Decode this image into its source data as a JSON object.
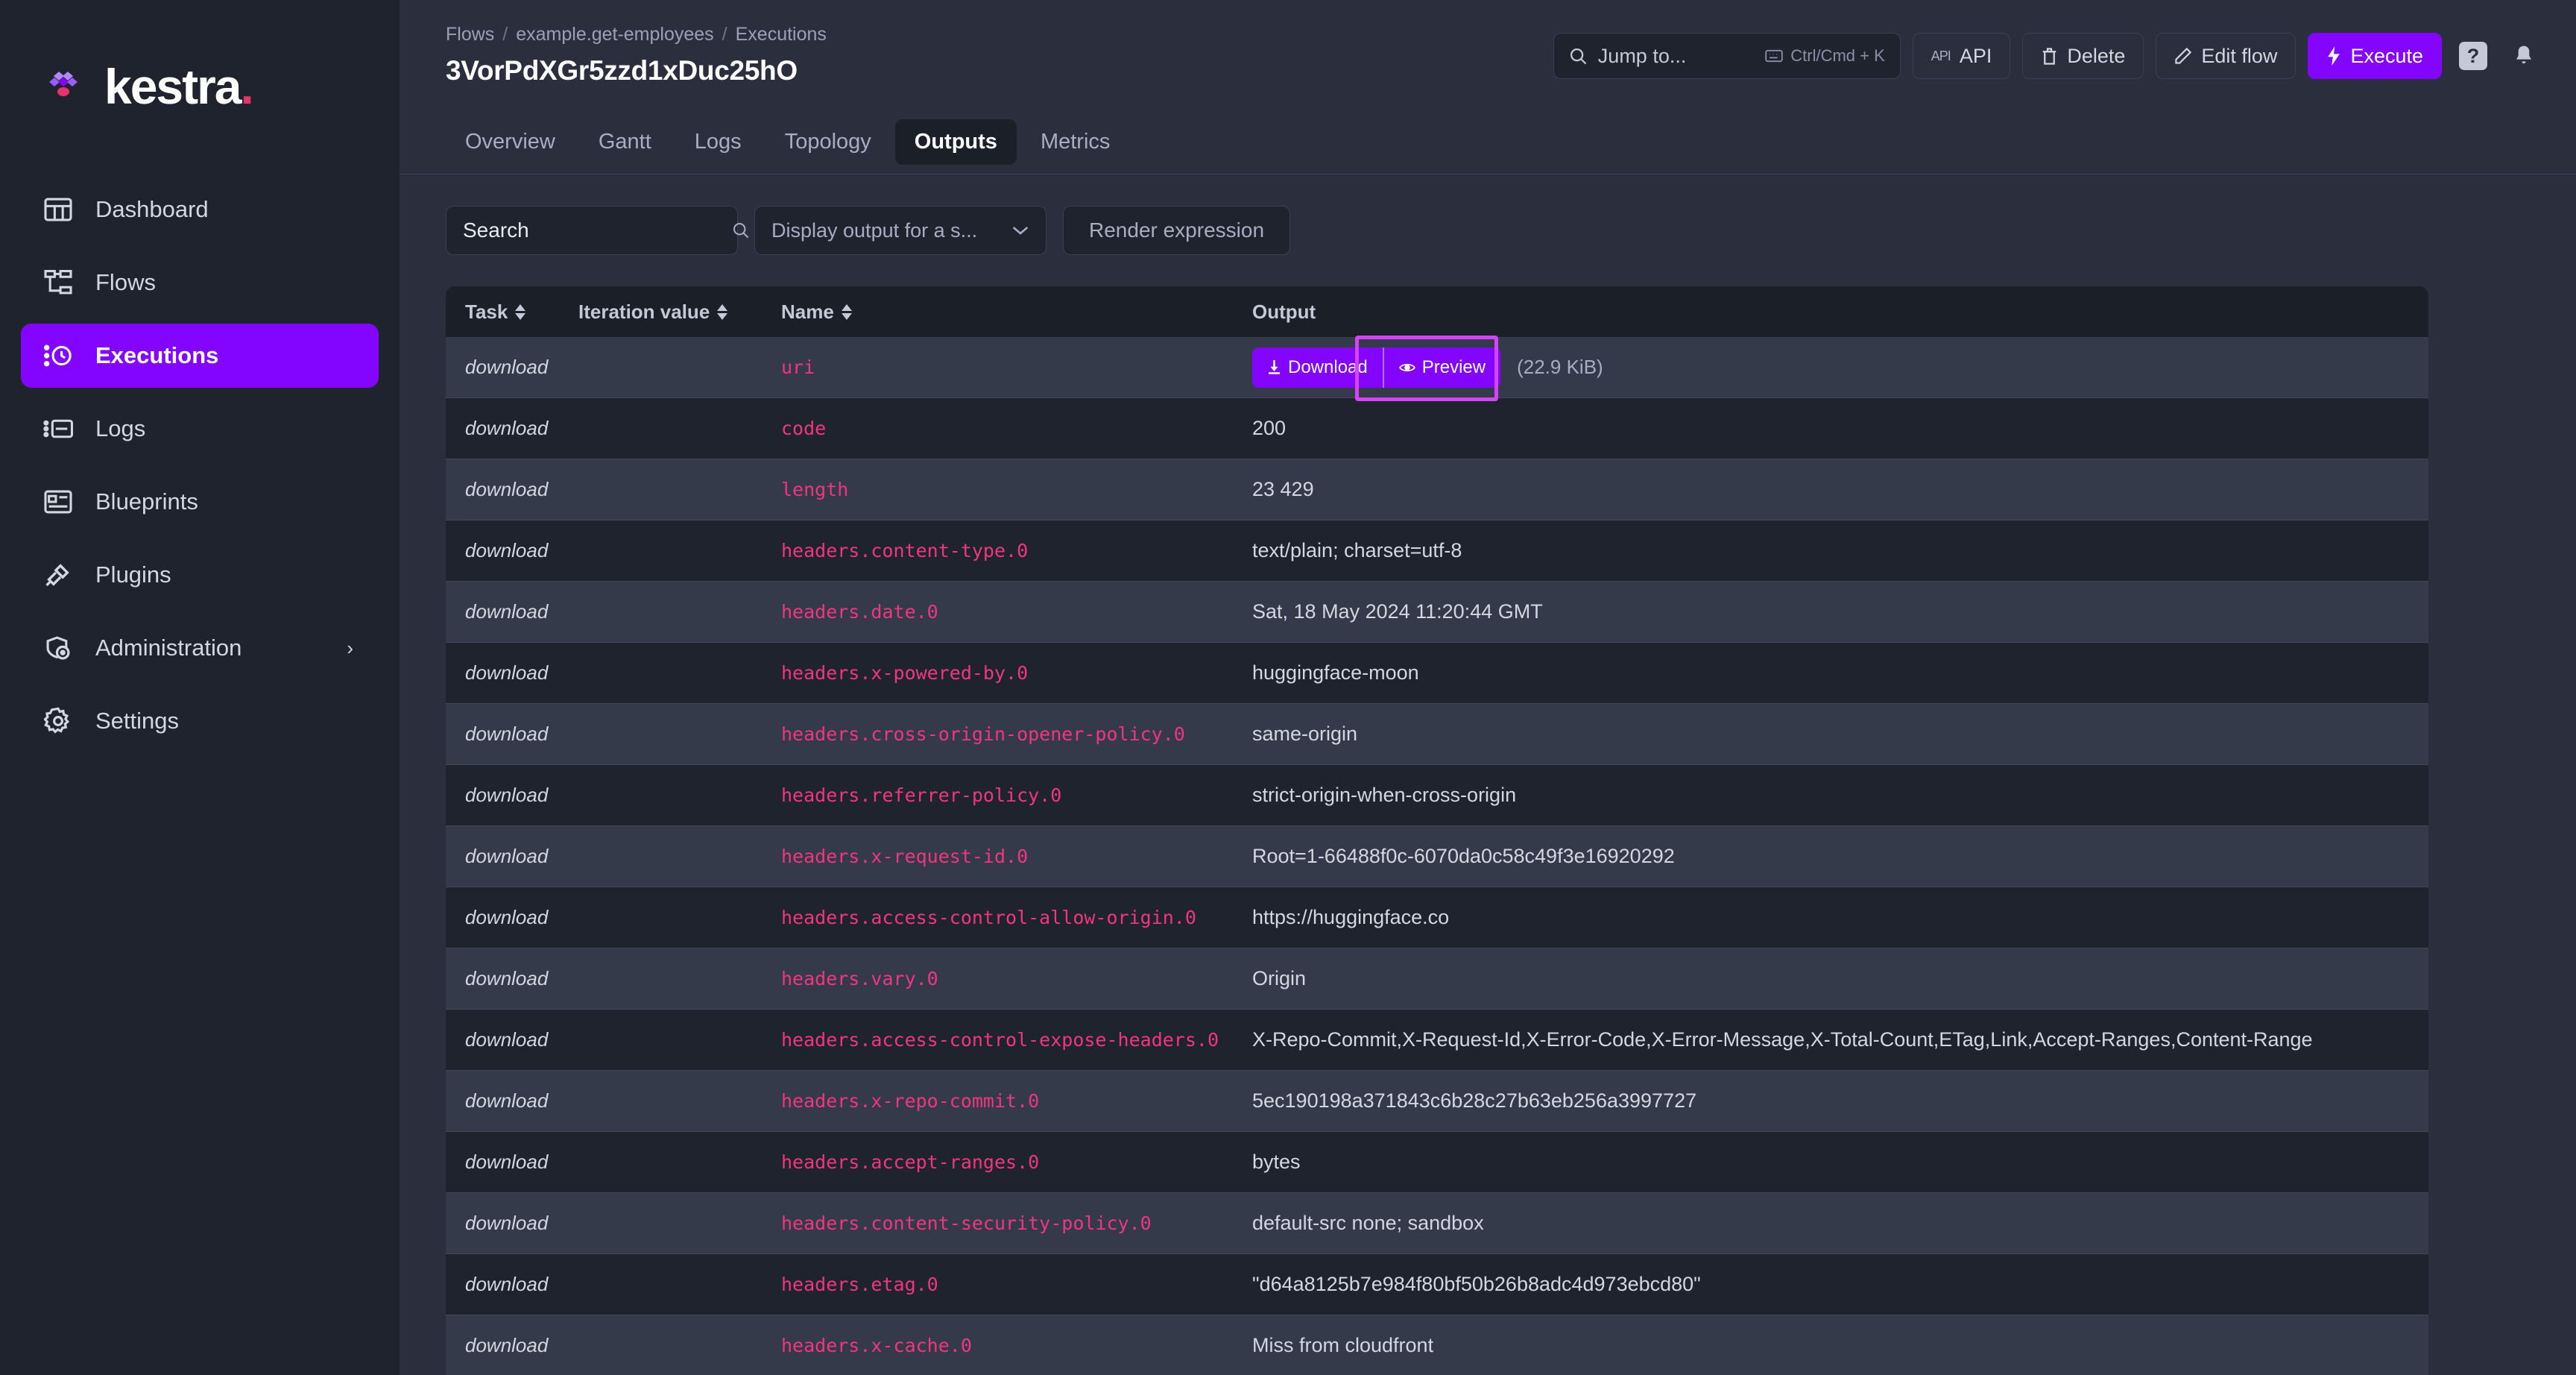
{
  "brand": {
    "name": "kestra",
    "dot": ".",
    "accent": "#8405ff",
    "pink": "#e5336b"
  },
  "sidebar": {
    "items": [
      {
        "label": "Dashboard",
        "icon": "dashboard-icon",
        "active": false,
        "chevron": ""
      },
      {
        "label": "Flows",
        "icon": "flows-icon",
        "active": false,
        "chevron": ""
      },
      {
        "label": "Executions",
        "icon": "executions-icon",
        "active": true,
        "chevron": ""
      },
      {
        "label": "Logs",
        "icon": "logs-icon",
        "active": false,
        "chevron": ""
      },
      {
        "label": "Blueprints",
        "icon": "blueprints-icon",
        "active": false,
        "chevron": ""
      },
      {
        "label": "Plugins",
        "icon": "plugins-icon",
        "active": false,
        "chevron": ""
      },
      {
        "label": "Administration",
        "icon": "administration-icon",
        "active": false,
        "chevron": "›"
      },
      {
        "label": "Settings",
        "icon": "settings-gear-icon",
        "active": false,
        "chevron": ""
      }
    ]
  },
  "header": {
    "breadcrumb": [
      "Flows",
      "example.get-employees",
      "Executions"
    ],
    "separator": "/",
    "title": "3VorPdXGr5zzd1xDuc25hO",
    "jump": {
      "placeholder": "Jump to...",
      "shortcut": "Ctrl/Cmd + K"
    },
    "buttons": [
      {
        "label": "API",
        "icon": "api-icon",
        "primary": false
      },
      {
        "label": "Delete",
        "icon": "trash-icon",
        "primary": false
      },
      {
        "label": "Edit flow",
        "icon": "pencil-icon",
        "primary": false
      },
      {
        "label": "Execute",
        "icon": "lightning-icon",
        "primary": true
      }
    ],
    "help_label": "?",
    "bell": "notifications-bell-icon"
  },
  "tabs": [
    {
      "label": "Overview",
      "active": false
    },
    {
      "label": "Gantt",
      "active": false
    },
    {
      "label": "Logs",
      "active": false
    },
    {
      "label": "Topology",
      "active": false
    },
    {
      "label": "Outputs",
      "active": true
    },
    {
      "label": "Metrics",
      "active": false
    }
  ],
  "filters": {
    "search_placeholder": "Search",
    "search_value": "",
    "select_label": "Display output for a s...",
    "render_button": "Render expression"
  },
  "table": {
    "columns": [
      {
        "label": "Task",
        "sortable": true
      },
      {
        "label": "Iteration value",
        "sortable": true
      },
      {
        "label": "Name",
        "sortable": true
      },
      {
        "label": "Output",
        "sortable": false
      }
    ],
    "rows": [
      {
        "task": "download",
        "iteration": "",
        "name": "uri",
        "output_type": "file",
        "download_label": "Download",
        "preview_label": "Preview",
        "size": "(22.9 KiB)",
        "highlighted": true
      },
      {
        "task": "download",
        "iteration": "",
        "name": "code",
        "output_type": "text",
        "output": "200"
      },
      {
        "task": "download",
        "iteration": "",
        "name": "length",
        "output_type": "text",
        "output": "23 429"
      },
      {
        "task": "download",
        "iteration": "",
        "name": "headers.content-type.0",
        "output_type": "text",
        "output": "text/plain; charset=utf-8"
      },
      {
        "task": "download",
        "iteration": "",
        "name": "headers.date.0",
        "output_type": "text",
        "output": "Sat, 18 May 2024 11:20:44 GMT"
      },
      {
        "task": "download",
        "iteration": "",
        "name": "headers.x-powered-by.0",
        "output_type": "text",
        "output": "huggingface-moon"
      },
      {
        "task": "download",
        "iteration": "",
        "name": "headers.cross-origin-opener-policy.0",
        "output_type": "text",
        "output": "same-origin"
      },
      {
        "task": "download",
        "iteration": "",
        "name": "headers.referrer-policy.0",
        "output_type": "text",
        "output": "strict-origin-when-cross-origin"
      },
      {
        "task": "download",
        "iteration": "",
        "name": "headers.x-request-id.0",
        "output_type": "text",
        "output": "Root=1-66488f0c-6070da0c58c49f3e16920292"
      },
      {
        "task": "download",
        "iteration": "",
        "name": "headers.access-control-allow-origin.0",
        "output_type": "text",
        "output": "https://huggingface.co"
      },
      {
        "task": "download",
        "iteration": "",
        "name": "headers.vary.0",
        "output_type": "text",
        "output": "Origin"
      },
      {
        "task": "download",
        "iteration": "",
        "name": "headers.access-control-expose-headers.0",
        "output_type": "text",
        "output": "X-Repo-Commit,X-Request-Id,X-Error-Code,X-Error-Message,X-Total-Count,ETag,Link,Accept-Ranges,Content-Range"
      },
      {
        "task": "download",
        "iteration": "",
        "name": "headers.x-repo-commit.0",
        "output_type": "text",
        "output": "5ec190198a371843c6b28c27b63eb256a3997727"
      },
      {
        "task": "download",
        "iteration": "",
        "name": "headers.accept-ranges.0",
        "output_type": "text",
        "output": "bytes"
      },
      {
        "task": "download",
        "iteration": "",
        "name": "headers.content-security-policy.0",
        "output_type": "text",
        "output": "default-src none; sandbox"
      },
      {
        "task": "download",
        "iteration": "",
        "name": "headers.etag.0",
        "output_type": "text",
        "output": "\"d64a8125b7e984f80bf50b26b8adc4d973ebcd80\""
      },
      {
        "task": "download",
        "iteration": "",
        "name": "headers.x-cache.0",
        "output_type": "text",
        "output": "Miss from cloudfront"
      }
    ]
  }
}
